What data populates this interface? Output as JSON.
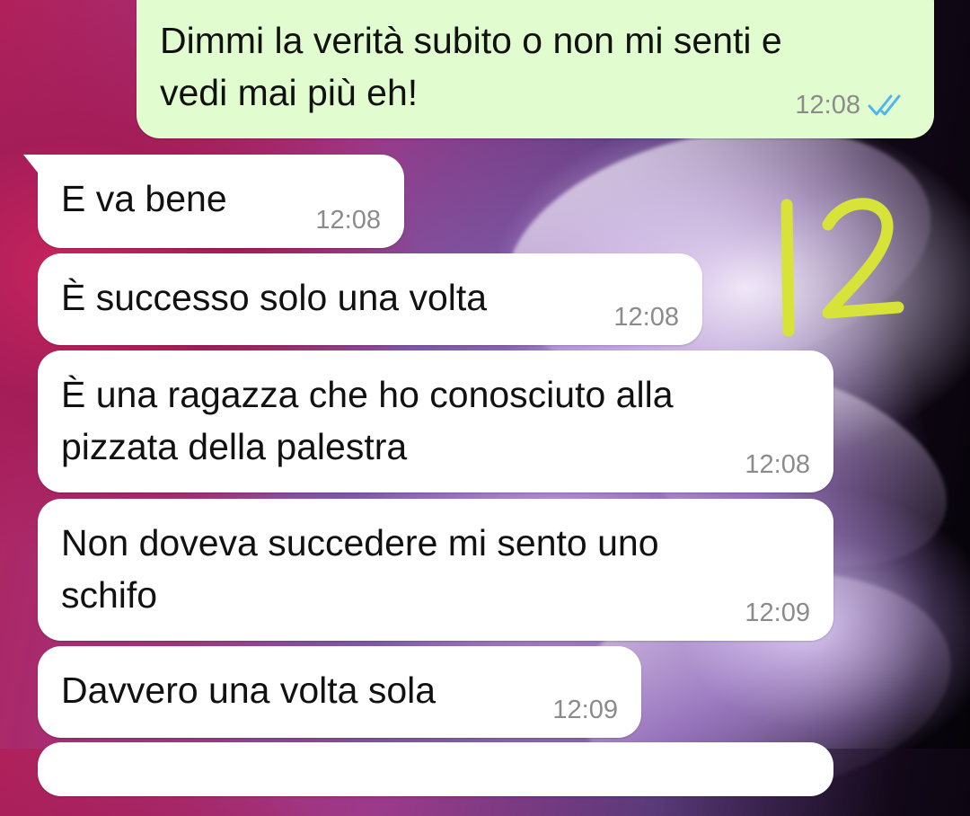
{
  "chat": {
    "messages": [
      {
        "direction": "outgoing",
        "text": "Dimmi la verità subito o non mi senti e\nvedi mai più eh!",
        "time": "12:08",
        "status": "read-double-check-icon"
      },
      {
        "direction": "incoming",
        "text": "E va bene",
        "time": "12:08"
      },
      {
        "direction": "incoming",
        "text": "È successo solo una volta",
        "time": "12:08"
      },
      {
        "direction": "incoming",
        "text": "È una ragazza che ho conosciuto alla\npizzata della palestra",
        "time": "12:08"
      },
      {
        "direction": "incoming",
        "text": "Non doveva succedere mi sento uno\nschifo",
        "time": "12:09"
      },
      {
        "direction": "incoming",
        "text": "Davvero una volta sola",
        "time": "12:09"
      }
    ]
  },
  "annotation": {
    "text": "12",
    "color": "#d8e33a"
  },
  "colors": {
    "outgoing_bubble": "#e1fdd0",
    "incoming_bubble": "#ffffff",
    "read_tick": "#4fb6ec",
    "timestamp": "#8b8b8b"
  }
}
